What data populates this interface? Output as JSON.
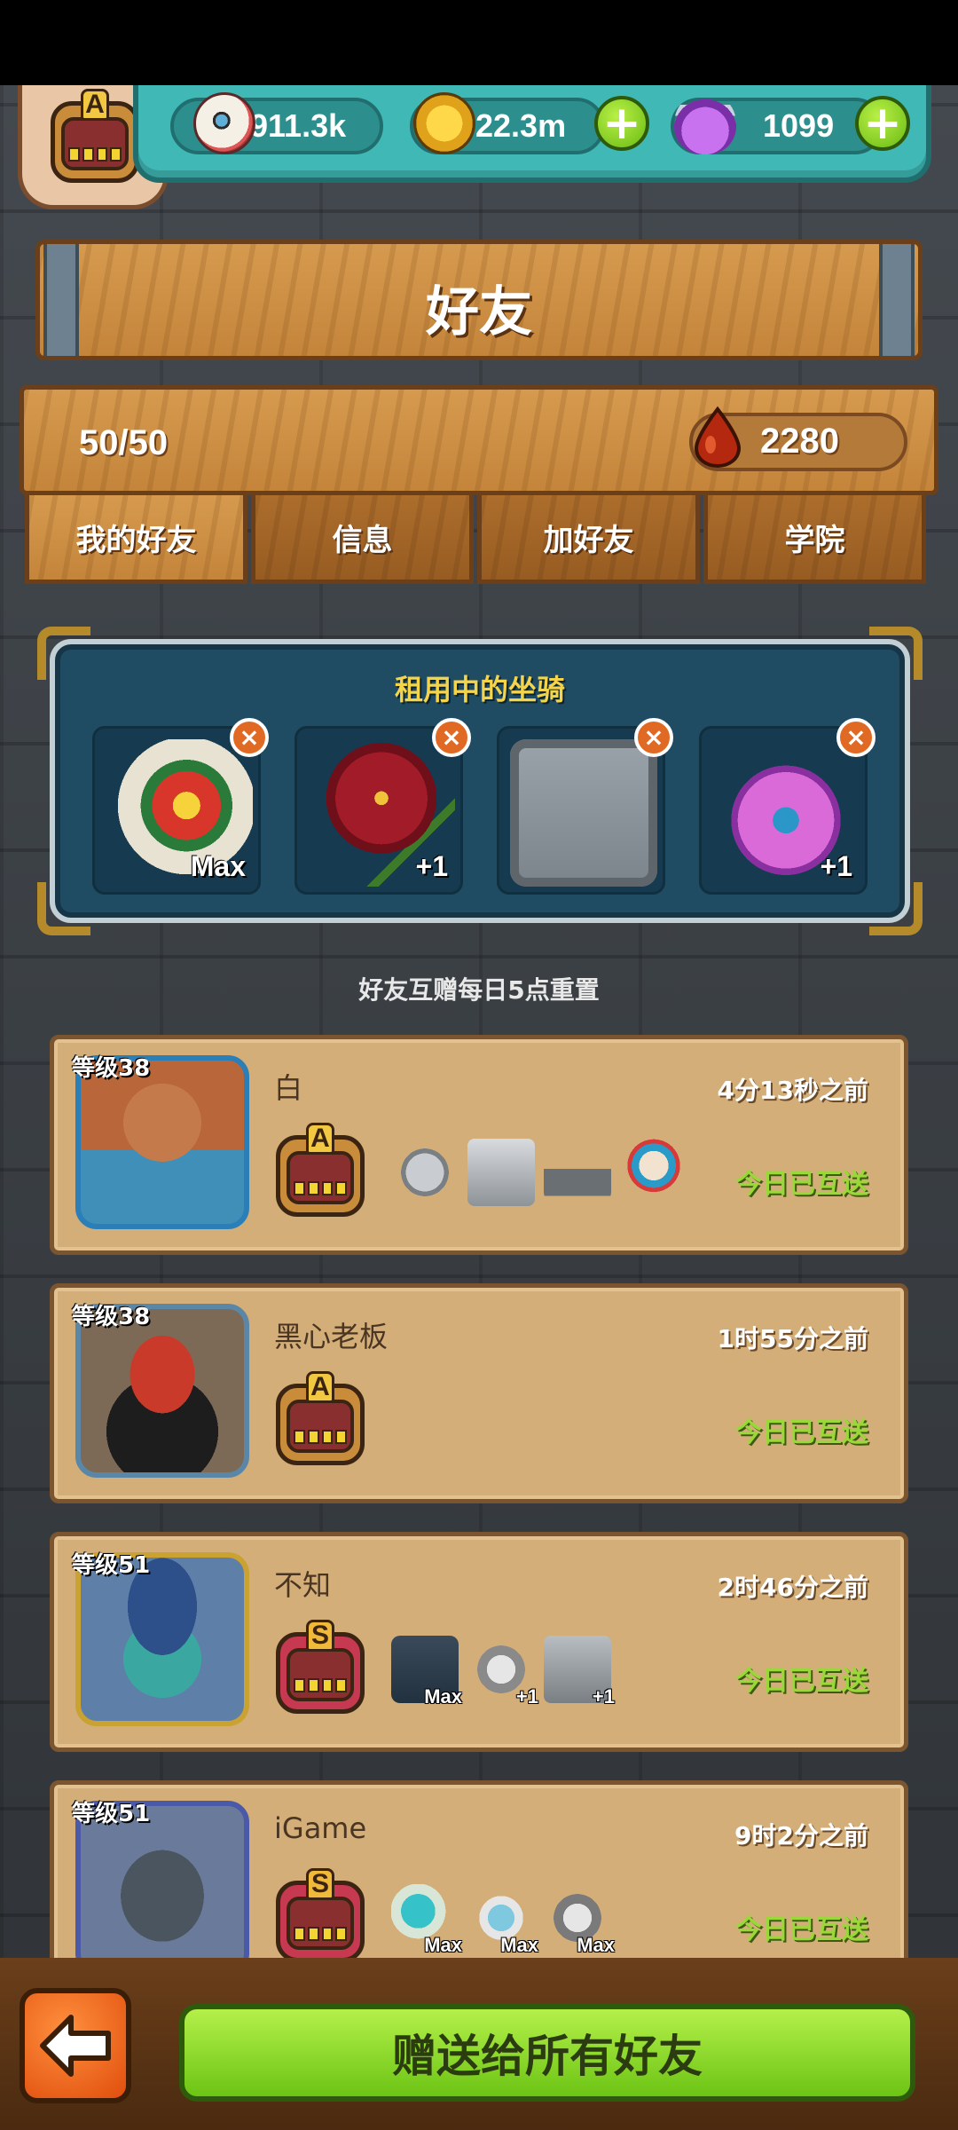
{
  "resources": {
    "eyes": "911.3k",
    "coins": "22.3m",
    "potion": "1099",
    "eye_icon": "eye-icon",
    "coin_icon": "coin-icon",
    "potion_icon": "potion-icon"
  },
  "player_badge": {
    "rank": "A"
  },
  "title": "好友",
  "friend_count": "50/50",
  "blood": "2280",
  "tabs": [
    {
      "label": "我的好友",
      "active": true
    },
    {
      "label": "信息",
      "active": false
    },
    {
      "label": "加好友",
      "active": false
    },
    {
      "label": "学院",
      "active": false
    }
  ],
  "rented_mounts": {
    "title": "租用中的坐骑",
    "items": [
      {
        "level": "Max",
        "color": "#c43a2a"
      },
      {
        "level": "+1",
        "color": "#a11c28"
      },
      {
        "level": "",
        "color": "#9aa3aa"
      },
      {
        "level": "+1",
        "color": "#b23bc0"
      }
    ]
  },
  "reset_note": "好友互赠每日5点重置",
  "friends": [
    {
      "level": "等级38",
      "name": "白",
      "time": "4分13秒之前",
      "status": "今日已互送",
      "rank": "A",
      "mounts": [
        {
          "level": ""
        },
        {
          "level": ""
        },
        {
          "level": ""
        },
        {
          "level": ""
        }
      ]
    },
    {
      "level": "等级38",
      "name": "黑心老板",
      "time": "1时55分之前",
      "status": "今日已互送",
      "rank": "A",
      "mounts": []
    },
    {
      "level": "等级51",
      "name": "不知",
      "time": "2时46分之前",
      "status": "今日已互送",
      "rank": "S",
      "mounts": [
        {
          "level": "Max"
        },
        {
          "level": "+1"
        },
        {
          "level": "+1"
        }
      ]
    },
    {
      "level": "等级51",
      "name": "iGame",
      "time": "9时2分之前",
      "status": "今日已互送",
      "rank": "S",
      "mounts": [
        {
          "level": "Max"
        },
        {
          "level": "Max"
        },
        {
          "level": "Max"
        }
      ]
    }
  ],
  "send_all_button": "赠送给所有好友"
}
